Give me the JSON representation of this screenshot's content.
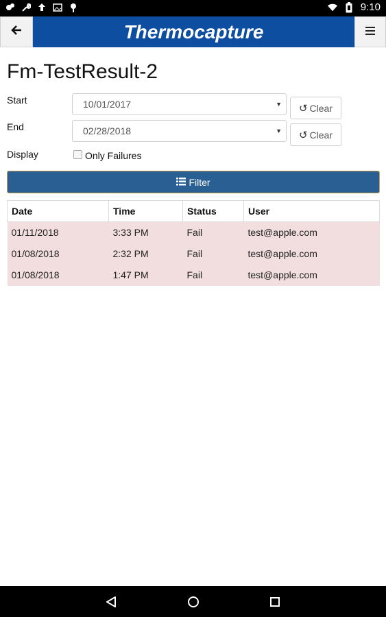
{
  "status_bar": {
    "time": "9:10",
    "left_icons": [
      "notification-icon",
      "wrench-icon",
      "upload-icon",
      "image-icon",
      "location-icon"
    ],
    "right_icons": [
      "wifi-icon",
      "battery-icon"
    ]
  },
  "app_bar": {
    "title": "Thermocapture",
    "back_icon": "arrow-left-icon",
    "menu_icon": "hamburger-icon"
  },
  "page": {
    "title": "Fm-TestResult-2"
  },
  "filters": {
    "start_label": "Start",
    "start_value": "10/01/2017",
    "end_label": "End",
    "end_value": "02/28/2018",
    "clear_label": "Clear",
    "display_label": "Display",
    "only_failures_label": "Only Failures",
    "only_failures_checked": false,
    "filter_label": "Filter"
  },
  "table": {
    "headers": [
      "Date",
      "Time",
      "Status",
      "User"
    ],
    "rows": [
      [
        "01/11/2018",
        "3:33 PM",
        "Fail",
        "test@apple.com"
      ],
      [
        "01/08/2018",
        "2:32 PM",
        "Fail",
        "test@apple.com"
      ],
      [
        "01/08/2018",
        "1:47 PM",
        "Fail",
        "test@apple.com"
      ]
    ],
    "fail_row_color": "#f2dede"
  },
  "colors": {
    "brand": "#0d4ea0",
    "filter_button": "#2a5f93"
  }
}
